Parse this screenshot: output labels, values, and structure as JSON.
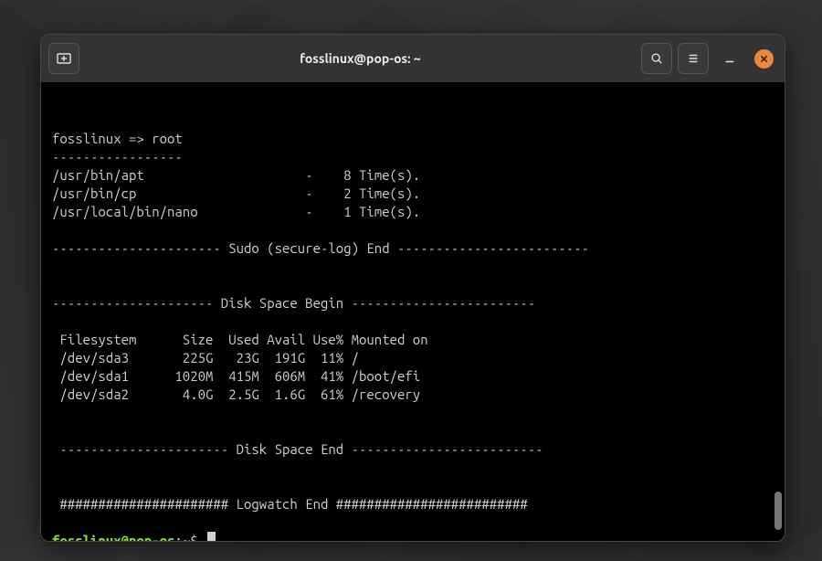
{
  "window": {
    "title": "fosslinux@pop-os: ~"
  },
  "terminal": {
    "lines": {
      "l0": "",
      "l1": "fosslinux => root",
      "l2": "-----------------",
      "l3": "/usr/bin/apt                     -    8 Time(s).",
      "l4": "/usr/bin/cp                      -    2 Time(s).",
      "l5": "/usr/local/bin/nano              -    1 Time(s).",
      "l6": "",
      "l7": "---------------------- Sudo (secure-log) End -------------------------",
      "l8": "",
      "l9": "",
      "l10": "--------------------- Disk Space Begin ------------------------",
      "l11": "",
      "l12": " Filesystem      Size  Used Avail Use% Mounted on",
      "l13": " /dev/sda3       225G   23G  191G  11% /",
      "l14": " /dev/sda1      1020M  415M  606M  41% /boot/efi",
      "l15": " /dev/sda2       4.0G  2.5G  1.6G  61% /recovery",
      "l16": "",
      "l17": "",
      "l18": " ---------------------- Disk Space End -------------------------",
      "l19": "",
      "l20": "",
      "l21": " ###################### Logwatch End #########################",
      "l22": ""
    },
    "prompt": {
      "user_host": "fosslinux@pop-os",
      "sep": ":",
      "path": "~",
      "symbol": "$"
    }
  }
}
